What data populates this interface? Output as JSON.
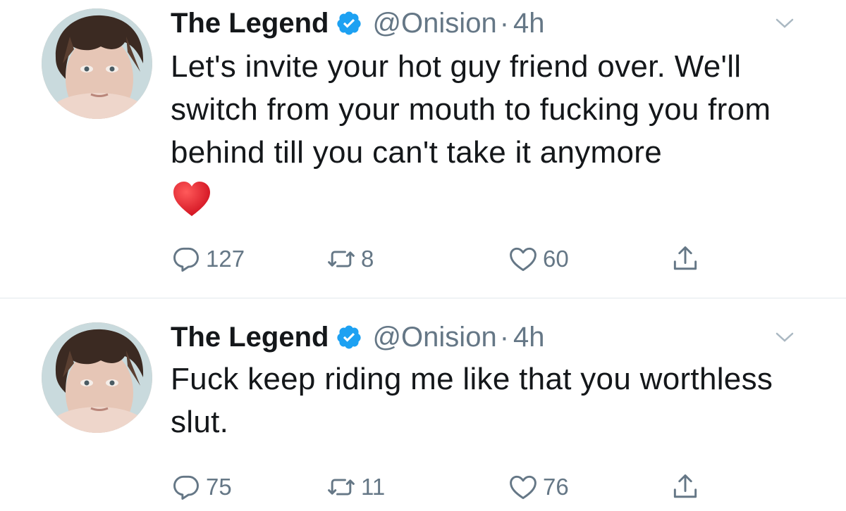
{
  "tweets": [
    {
      "display_name": "The Legend",
      "handle": "@Onision",
      "separator": "·",
      "time": "4h",
      "text": "Let's invite your hot guy friend over. We'll switch from your mouth to fucking you from behind till you can't take it anymore",
      "emoji": "red-heart",
      "replies": "127",
      "retweets": "8",
      "likes": "60"
    },
    {
      "display_name": "The Legend",
      "handle": "@Onision",
      "separator": "·",
      "time": "4h",
      "text": "Fuck keep riding me like that you worthless slut.",
      "replies": "75",
      "retweets": "11",
      "likes": "76"
    }
  ],
  "colors": {
    "text": "#14171a",
    "secondary": "#657786",
    "verified_blue": "#1da1f2",
    "divider": "#e1e8ed",
    "heart_red": "#e0182d"
  },
  "icons": [
    "verified-badge-icon",
    "chevron-down-icon",
    "reply-icon",
    "retweet-icon",
    "like-icon",
    "share-icon"
  ]
}
